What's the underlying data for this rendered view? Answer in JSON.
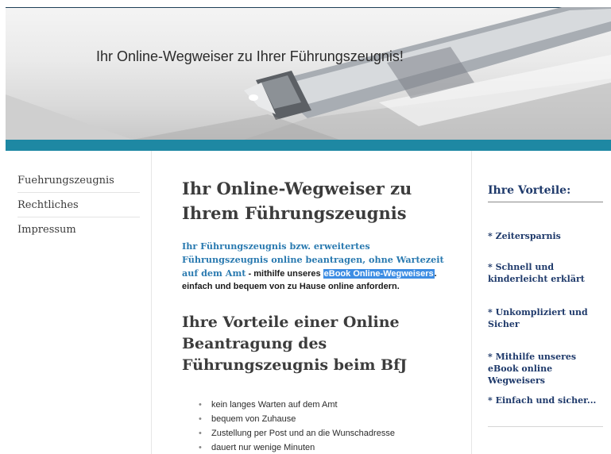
{
  "header": {
    "title": "Ihr Online-Wegweiser zu Ihrer Führungszeugnis!"
  },
  "nav": {
    "items": [
      {
        "label": "Fuehrungszeugnis"
      },
      {
        "label": "Rechtliches"
      },
      {
        "label": "Impressum"
      }
    ]
  },
  "main": {
    "heading": "Ihr Online-Wegweiser zu Ihrem Führungszeugnis",
    "intro_lead": "Ihr Führungszeugnis bzw. erweitertes Führungszeugnis online beantragen, ohne Wartezeit auf dem Amt",
    "intro_mid": " - mithilfe unseres ",
    "intro_highlight": "eBook Online-Wegweisers",
    "intro_end": ". einfach und bequem von zu Hause online anfordern.",
    "subheading": "Ihre Vorteile einer Online Beantragung des Führungszeugnis beim BfJ",
    "benefits": [
      "kein langes Warten auf dem Amt",
      "bequem von Zuhause",
      "Zustellung per Post und an die Wunschadresse",
      "dauert nur wenige Minuten"
    ]
  },
  "sidebar": {
    "title": "Ihre Vorteile:",
    "items": [
      "* Zeitersparnis",
      "* Schnell und kinderleicht erklärt",
      "* Unkompliziert und Sicher",
      "* Mithilfe unseres eBook online Wegweisers",
      "* Einfach und sicher..."
    ]
  },
  "colors": {
    "teal_bar": "#1e88a3",
    "lead_text": "#2a7ab0",
    "sidebar_text": "#1f3a6b",
    "highlight": "#3e8de3"
  }
}
